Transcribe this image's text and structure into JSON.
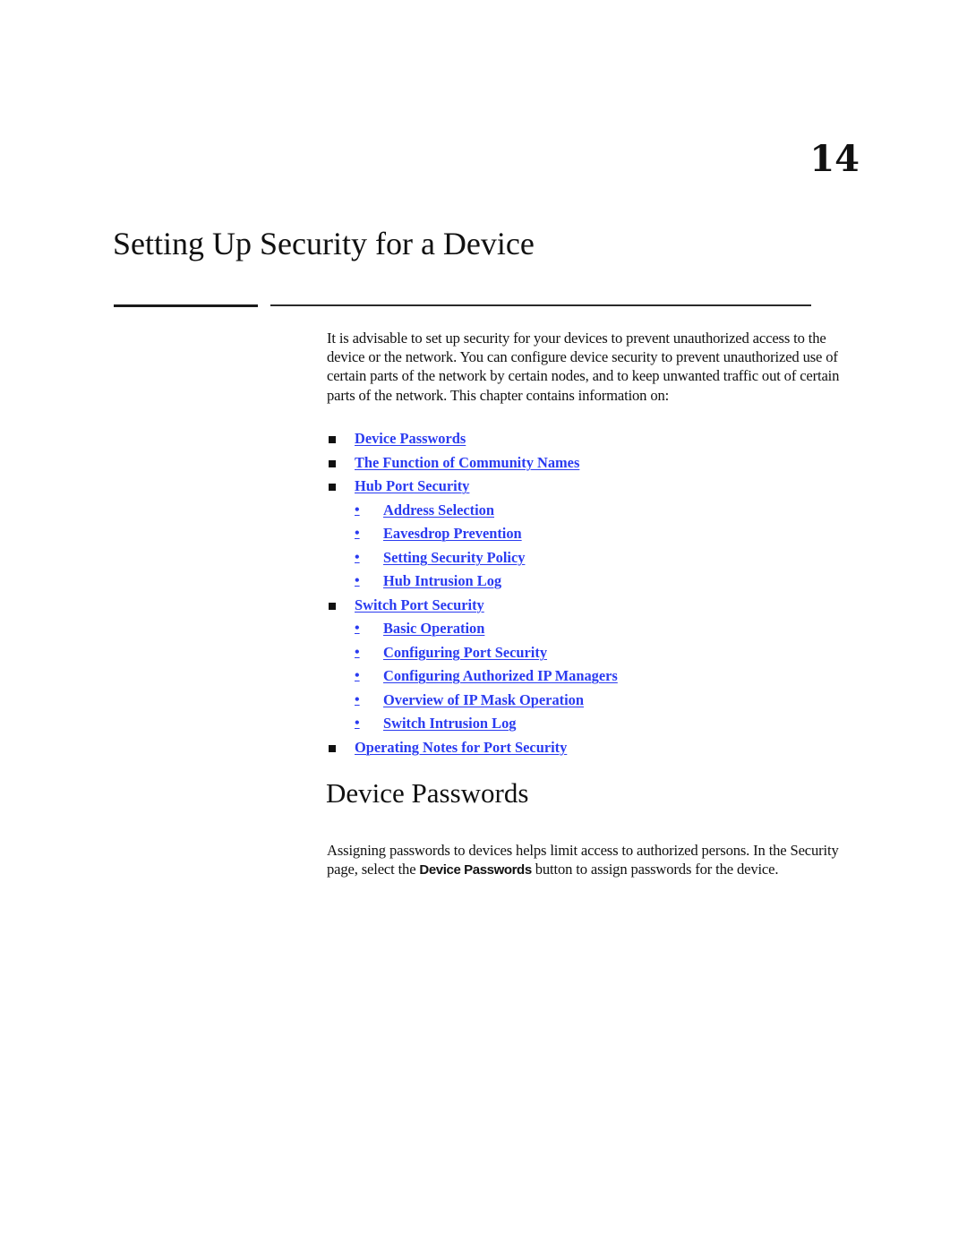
{
  "chapter": {
    "number": "14",
    "title": "Setting Up Security for a Device"
  },
  "intro": {
    "text": "It is advisable to set up security for your devices to prevent unauthorized access to the device or the network. You can configure device security to prevent unauthorized use of certain parts of the network by certain nodes, and to keep unwanted traffic out of certain parts of the network. This chapter contains information on:"
  },
  "toc": {
    "link_color": "#2a3bf0",
    "items": [
      {
        "level": 1,
        "label": "Device Passwords"
      },
      {
        "level": 1,
        "label": "The Function of Community Names"
      },
      {
        "level": 1,
        "label": "Hub Port Security"
      },
      {
        "level": 2,
        "label": "Address Selection"
      },
      {
        "level": 2,
        "label": "Eavesdrop Prevention"
      },
      {
        "level": 2,
        "label": "Setting Security Policy"
      },
      {
        "level": 2,
        "label": "Hub Intrusion Log"
      },
      {
        "level": 1,
        "label": "Switch Port Security"
      },
      {
        "level": 2,
        "label": "Basic Operation"
      },
      {
        "level": 2,
        "label": "Configuring Port Security"
      },
      {
        "level": 2,
        "label": "Configuring Authorized IP Managers"
      },
      {
        "level": 2,
        "label": "Overview of IP Mask Operation"
      },
      {
        "level": 2,
        "label": "Switch Intrusion Log"
      },
      {
        "level": 1,
        "label": "Operating Notes for Port Security"
      }
    ],
    "bullet_symbol": "•"
  },
  "section": {
    "title": "Device Passwords",
    "para_before": "Assigning passwords to devices helps limit access to authorized persons. In the Security page, select the ",
    "ui_term": "Device Passwords",
    "para_after": " button to assign passwords for the device."
  }
}
